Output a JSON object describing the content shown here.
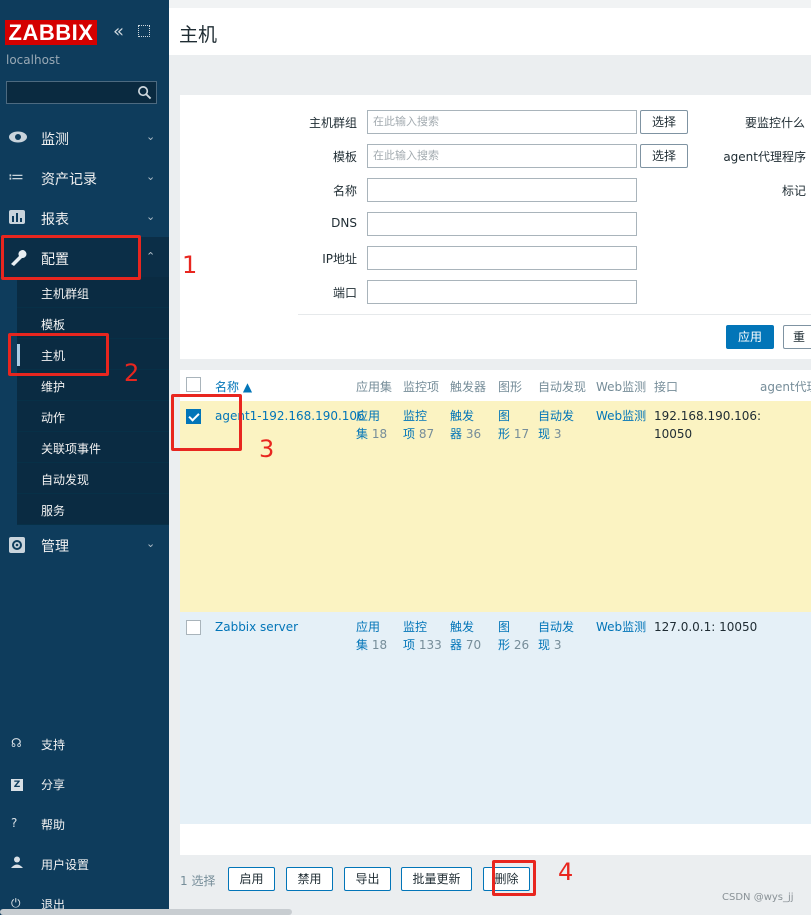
{
  "brand": {
    "logo": "ZABBIX",
    "server": "localhost"
  },
  "sidebar": {
    "menu": [
      {
        "label": "监测",
        "icon": "eye-icon"
      },
      {
        "label": "资产记录",
        "icon": "list-icon"
      },
      {
        "label": "报表",
        "icon": "chart-icon"
      },
      {
        "label": "配置",
        "icon": "wrench-icon"
      },
      {
        "label": "管理",
        "icon": "gear-icon"
      }
    ],
    "submenu": [
      "主机群组",
      "模板",
      "主机",
      "维护",
      "动作",
      "关联项事件",
      "自动发现",
      "服务"
    ],
    "bottom": [
      {
        "label": "支持",
        "icon": "headset-icon"
      },
      {
        "label": "分享",
        "icon": "share-icon"
      },
      {
        "label": "帮助",
        "icon": "help-icon"
      },
      {
        "label": "用户设置",
        "icon": "user-icon"
      },
      {
        "label": "退出",
        "icon": "power-icon"
      }
    ]
  },
  "header": {
    "title": "主机"
  },
  "filter": {
    "host_group_label": "主机群组",
    "host_group_placeholder": "在此输入搜索",
    "template_label": "模板",
    "template_placeholder": "在此输入搜索",
    "name_label": "名称",
    "dns_label": "DNS",
    "ip_label": "IP地址",
    "port_label": "端口",
    "select_button": "选择",
    "monitored_by_label": "要监控什么",
    "proxy_label": "agent代理程序",
    "tags_label": "标记",
    "apply_button": "应用",
    "reset_button": "重"
  },
  "table": {
    "headers": [
      "名称 ▲",
      "应用集",
      "监控项",
      "触发器",
      "图形",
      "自动发现",
      "Web监测",
      "接口",
      "agent代理"
    ],
    "rows": [
      {
        "name": "agent1-192.168.190.106",
        "apps": [
          "应用",
          "集",
          "18"
        ],
        "items": [
          "监控",
          "项",
          "87"
        ],
        "triggers": [
          "触发",
          "器",
          "36"
        ],
        "graphs": [
          "图",
          "形",
          "17"
        ],
        "discovery": [
          "自动发",
          "现",
          "3"
        ],
        "web": "Web监测",
        "interface": [
          "192.168.190.106:",
          "10050"
        ]
      },
      {
        "name": "Zabbix server",
        "apps": [
          "应用",
          "集",
          "18"
        ],
        "items": [
          "监控",
          "项",
          "133"
        ],
        "triggers": [
          "触发",
          "器",
          "70"
        ],
        "graphs": [
          "图",
          "形",
          "26"
        ],
        "discovery": [
          "自动发",
          "现",
          "3"
        ],
        "web": "Web监测",
        "interface": [
          "127.0.0.1: 10050"
        ]
      }
    ]
  },
  "footer": {
    "selected": "1 选择",
    "buttons": [
      "启用",
      "禁用",
      "导出",
      "批量更新",
      "删除"
    ]
  },
  "annotations": [
    "1",
    "2",
    "3",
    "4"
  ],
  "watermark": "CSDN @wys_jj"
}
